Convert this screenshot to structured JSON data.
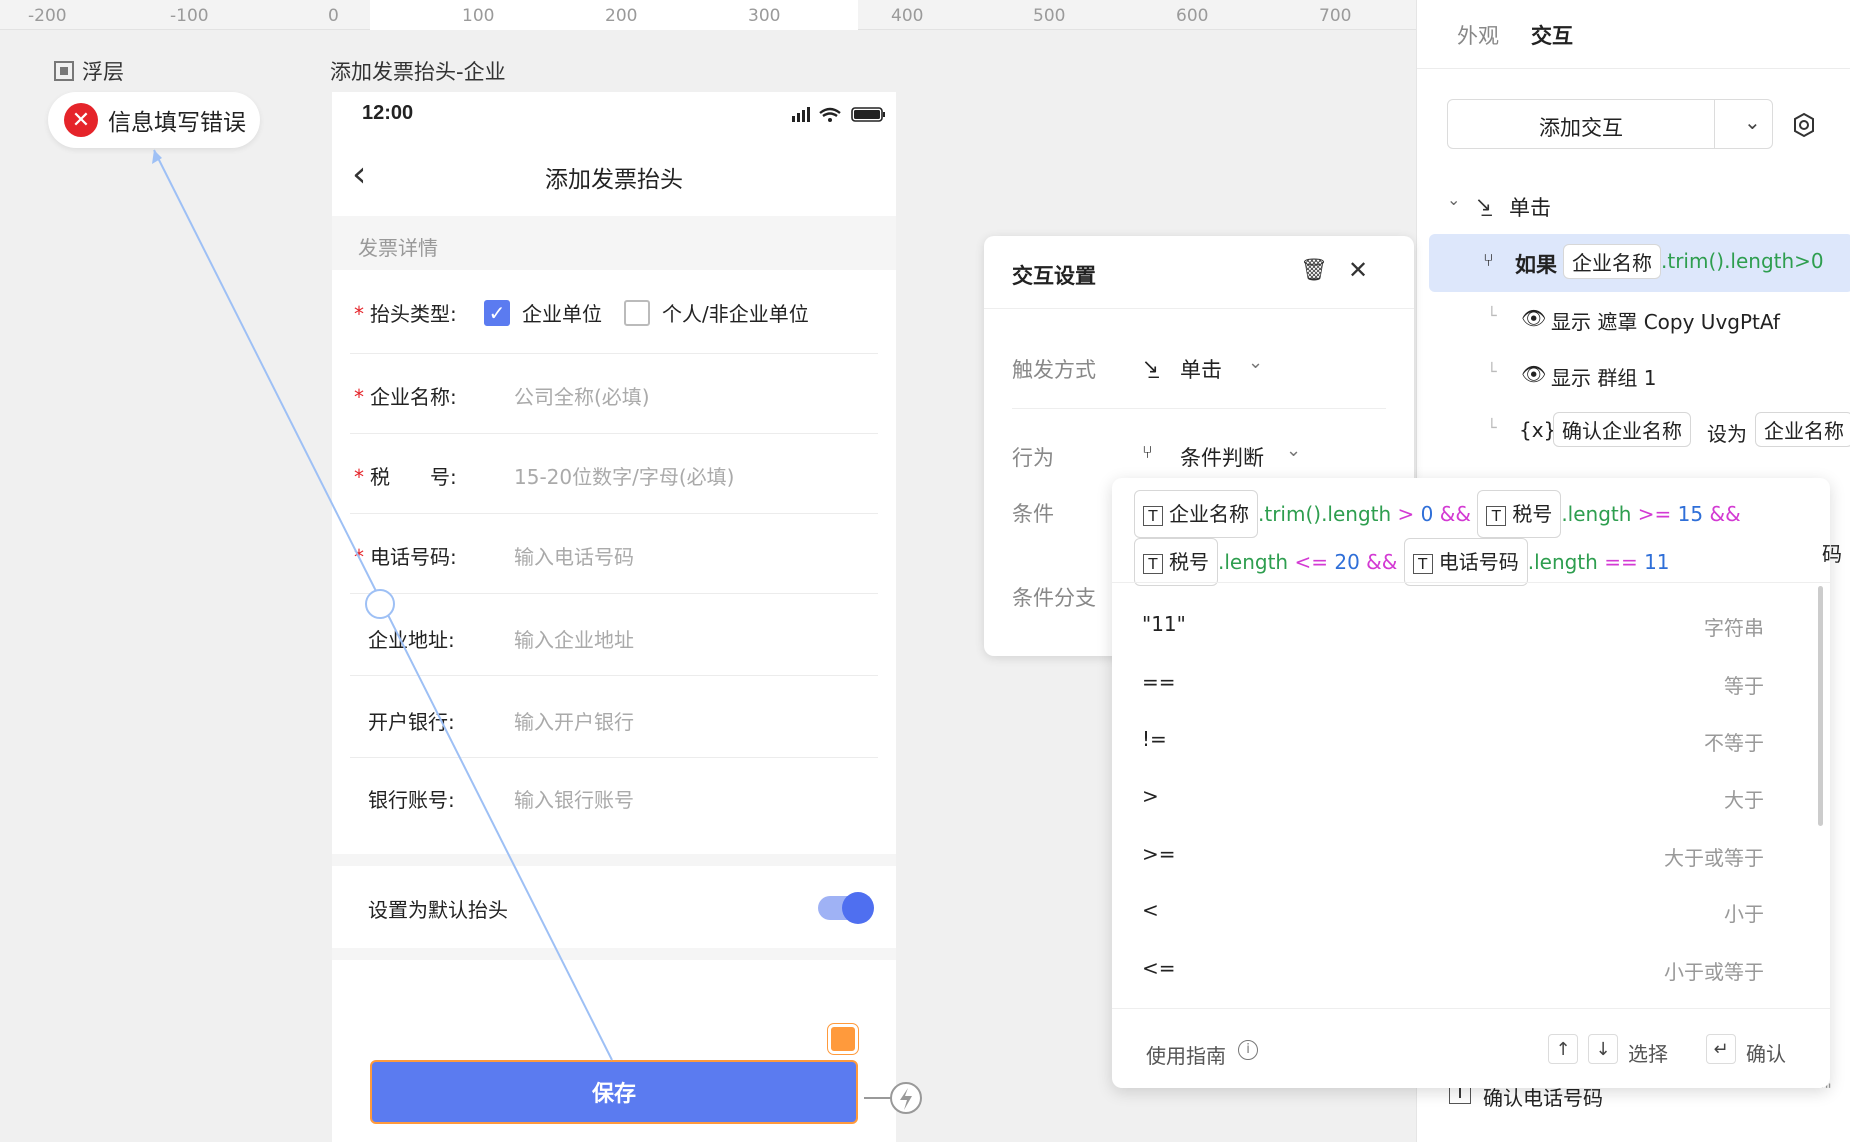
{
  "ruler": {
    "ticks": [
      "-200",
      "-100",
      "0",
      "100",
      "200",
      "300",
      "400",
      "500",
      "600",
      "700"
    ]
  },
  "canvas": {
    "layer_label": "浮层",
    "toast_text": "信息填写错误",
    "frame_label": "添加发票抬头-企业"
  },
  "phone": {
    "time": "12:00",
    "nav_title": "添加发票抬头",
    "section": "发票详情",
    "rows": {
      "type_label": "抬头类型:",
      "opt_company": "企业单位",
      "opt_personal": "个人/非企业单位",
      "company_label": "企业名称:",
      "company_ph": "公司全称(必填)",
      "tax_label": "税　　号:",
      "tax_ph": "15-20位数字/字母(必填)",
      "phone_label": "电话号码:",
      "phone_ph": "输入电话号码",
      "addr_label": "企业地址:",
      "addr_ph": "输入企业地址",
      "bank_label": "开户银行:",
      "bank_ph": "输入开户银行",
      "acct_label": "银行账号:",
      "acct_ph": "输入银行账号"
    },
    "default_label": "设置为默认抬头",
    "save_label": "保存"
  },
  "right_panel": {
    "tab_appearance": "外观",
    "tab_interaction": "交互",
    "add_interaction": "添加交互",
    "trigger": "单击",
    "if_label": "如果",
    "if_chip": "企业名称",
    "if_expr": ".trim().length>0",
    "action1": "显示 遮罩 Copy UvgPtAf",
    "action2": "显示 群组 1",
    "set_var_icon": "{x}",
    "set_var_chip": "确认企业名称",
    "set_to": "设为",
    "set_val_chip": "企业名称",
    "bottom_item": "确认电话号码",
    "bottom_quote": "\"\""
  },
  "interaction_settings": {
    "title": "交互设置",
    "trigger_label": "触发方式",
    "trigger_value": "单击",
    "behavior_label": "行为",
    "behavior_value": "条件判断",
    "condition_label": "条件",
    "branch_label": "条件分支"
  },
  "condition": {
    "c1_chip": "企业名称",
    "c1_method": ".trim().length",
    "c1_op": ">",
    "c1_val": "0",
    "and1": "&&",
    "c2_chip": "税号",
    "c2_method": ".length",
    "c2_op": ">=",
    "c2_val": "15",
    "and2": "&&",
    "c3_chip": "税号",
    "c3_method": ".length",
    "c3_op": "<=",
    "c3_val": "20",
    "and3": "&&",
    "c4_chip": "电话号码",
    "c4_method": ".length",
    "c4_op": "==",
    "c4_val": "11",
    "overflow_char": "码",
    "suggestions": [
      {
        "k": "\"11\"",
        "d": "字符串"
      },
      {
        "k": "==",
        "d": "等于"
      },
      {
        "k": "!=",
        "d": "不等于"
      },
      {
        "k": ">",
        "d": "大于"
      },
      {
        "k": ">=",
        "d": "大于或等于"
      },
      {
        "k": "<",
        "d": "小于"
      },
      {
        "k": "<=",
        "d": "小于或等于"
      }
    ],
    "guide": "使用指南",
    "select": "选择",
    "confirm": "确认"
  },
  "colors": {
    "primary": "#5b7bf0",
    "error": "#e5242a",
    "selected_bg": "#dde7fb",
    "orange": "#ff9a3c"
  }
}
